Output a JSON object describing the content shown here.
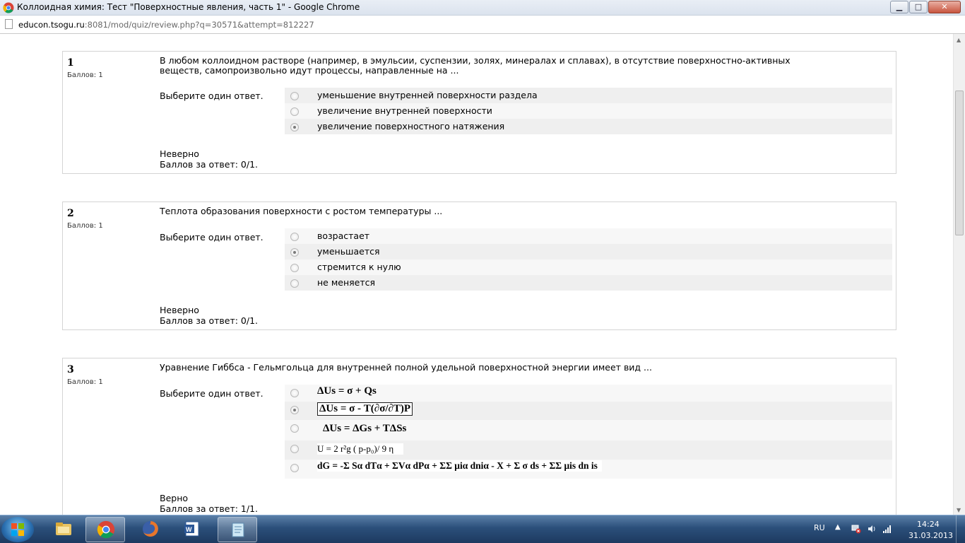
{
  "window": {
    "title": "Коллоидная химия: Тест \"Поверхностные явления, часть 1\" - Google Chrome",
    "controls": {
      "minimize": "▁",
      "maximize": "□",
      "close": "✕"
    }
  },
  "addressbar": {
    "host": "educon.tsogu.ru",
    "path": ":8081/mod/quiz/review.php?q=30571&attempt=812227"
  },
  "questions": [
    {
      "number": "1",
      "marks": "Баллов: 1",
      "text": "В любом коллоидном растворе (например, в эмульсии, суспензии, золях, минералах и сплавах), в отсутствие поверхностно-активных веществ, самопроизвольно идут процессы, направленные на ...",
      "prompt": "Выберите один ответ.",
      "answers": [
        {
          "label": "уменьшение внутренней поверхности раздела",
          "checked": false
        },
        {
          "label": "увеличение внутренней поверхности",
          "checked": false
        },
        {
          "label": "увеличение поверхностного натяжения",
          "checked": true
        }
      ],
      "feedback_status": "Неверно",
      "feedback_score": "Баллов за ответ: 0/1."
    },
    {
      "number": "2",
      "marks": "Баллов: 1",
      "text": "Теплота образования поверхности с ростом температуры ...",
      "prompt": "Выберите один ответ.",
      "answers": [
        {
          "label": "возрастает",
          "checked": false
        },
        {
          "label": "уменьшается",
          "checked": true
        },
        {
          "label": "стремится к нулю",
          "checked": false
        },
        {
          "label": "не меняется",
          "checked": false
        }
      ],
      "feedback_status": "Неверно",
      "feedback_score": "Баллов за ответ: 0/1."
    },
    {
      "number": "3",
      "marks": "Баллов: 1",
      "text": "Уравнение Гиббса - Гельмгольца для внутренней полной удельной поверхностной энергии имеет вид ...",
      "prompt": "Выберите один ответ.",
      "answers": [
        {
          "label": "ΔUs = σ + Qs",
          "checked": false
        },
        {
          "label": "ΔUs = σ - T(∂σ/∂T)P",
          "checked": true
        },
        {
          "label": "ΔUs = ΔGs + TΔSs",
          "checked": false
        },
        {
          "label": "U = 2 r²g ( p-p₀)/ 9 η",
          "checked": false
        },
        {
          "label": "dG = -Σ Sα dTα + ΣVα dPα + ΣΣ μiα dniα - X + Σ σ ds + ΣΣ μis dn is",
          "checked": false
        }
      ],
      "feedback_status": "Верно",
      "feedback_score": "Баллов за ответ: 1/1."
    }
  ],
  "taskbar": {
    "apps": [
      "folder-icon",
      "chrome-icon",
      "firefox-icon",
      "word-icon",
      "notepad-icon"
    ],
    "language": "RU",
    "time": "14:24",
    "date": "31.03.2013"
  }
}
